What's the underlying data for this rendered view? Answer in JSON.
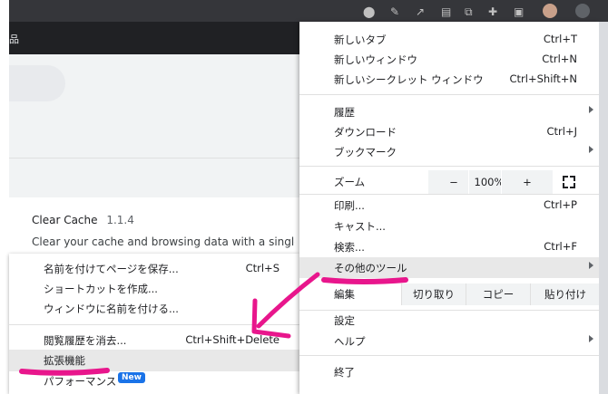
{
  "toolbar": {
    "account_icon_glyph": "品"
  },
  "extension_card": {
    "name": "Clear Cache",
    "version": "1.1.4",
    "description": "Clear your cache and browsing data with a single"
  },
  "submenu": {
    "items": [
      {
        "label": "名前を付けてページを保存...",
        "shortcut": "Ctrl+S"
      },
      {
        "label": "ショートカットを作成...",
        "shortcut": ""
      },
      {
        "label": "ウィンドウに名前を付ける...",
        "shortcut": ""
      },
      {
        "label": "閲覧履歴を消去...",
        "shortcut": "Ctrl+Shift+Delete"
      },
      {
        "label": "拡張機能",
        "shortcut": ""
      },
      {
        "label": "パフォーマンス",
        "badge": "New"
      }
    ]
  },
  "menu": {
    "new_tab": {
      "label": "新しいタブ",
      "shortcut": "Ctrl+T"
    },
    "new_window": {
      "label": "新しいウィンドウ",
      "shortcut": "Ctrl+N"
    },
    "new_incognito": {
      "label": "新しいシークレット ウィンドウ",
      "shortcut": "Ctrl+Shift+N"
    },
    "history": {
      "label": "履歴"
    },
    "downloads": {
      "label": "ダウンロード",
      "shortcut": "Ctrl+J"
    },
    "bookmarks": {
      "label": "ブックマーク"
    },
    "zoom": {
      "label": "ズーム",
      "minus": "−",
      "value": "100%",
      "plus": "+"
    },
    "print": {
      "label": "印刷...",
      "shortcut": "Ctrl+P"
    },
    "cast": {
      "label": "キャスト..."
    },
    "find": {
      "label": "検索...",
      "shortcut": "Ctrl+F"
    },
    "more_tools": {
      "label": "その他のツール"
    },
    "edit": {
      "label": "編集",
      "cut": "切り取り",
      "copy": "コピー",
      "paste": "貼り付け"
    },
    "settings": {
      "label": "設定"
    },
    "help": {
      "label": "ヘルプ"
    },
    "exit": {
      "label": "終了"
    }
  },
  "annotation": {
    "color": "#e8168c",
    "arrow_color": "#e8168c"
  }
}
